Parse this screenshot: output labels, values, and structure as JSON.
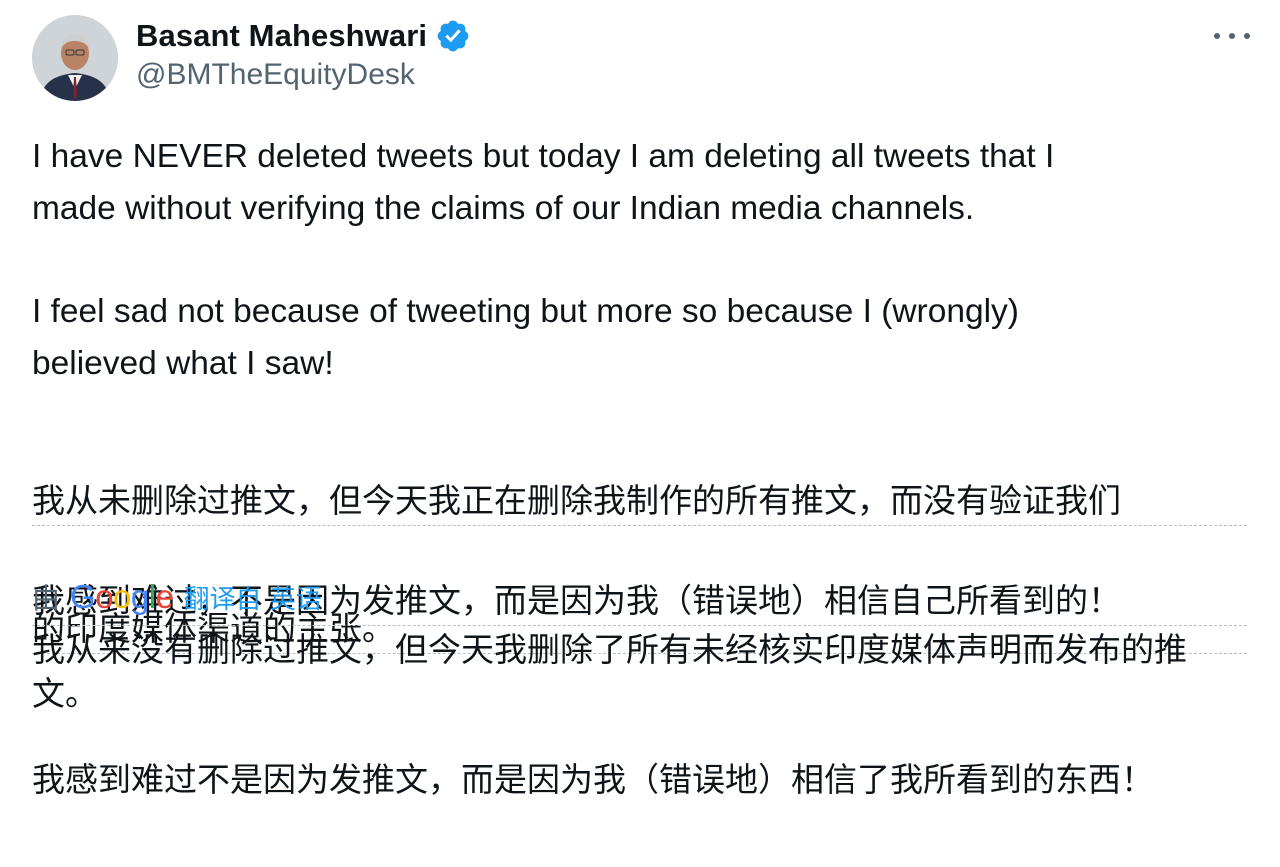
{
  "author": {
    "name": "Basant Maheshwari",
    "handle": "@BMTheEquityDesk",
    "verified": true
  },
  "icons": {
    "verified": "verified-badge-icon",
    "more": "more-horizontal-icon"
  },
  "colors": {
    "verified_blue": "#1d9bf0",
    "secondary_text": "#536471",
    "link_blue": "#1d9bf0"
  },
  "tweet": {
    "paragraph1": "I have NEVER deleted tweets but today I am deleting all tweets that I\nmade without verifying the claims of our Indian media channels.",
    "paragraph2": "I feel sad not because of tweeting but more so because I (wrongly)\nbelieved what I saw!"
  },
  "inline_translation": {
    "line1": "我从未删除过推文，但今天我正在删除我制作的所有推文，而没有验证我们",
    "line2": "的印度媒体渠道的主张。",
    "line3": "我感到难过，不是因为发推文，而是因为我（错误地）相信自己所看到的！"
  },
  "translation_attribution": {
    "by": "由",
    "provider": "Google",
    "translated_from": "翻译自 英语"
  },
  "google_translation": {
    "paragraph1": "我从来没有删除过推文，但今天我删除了所有未经核实印度媒体声明而发布的推文。",
    "paragraph2": "我感到难过不是因为发推文，而是因为我（错误地）相信了我所看到的东西！"
  }
}
